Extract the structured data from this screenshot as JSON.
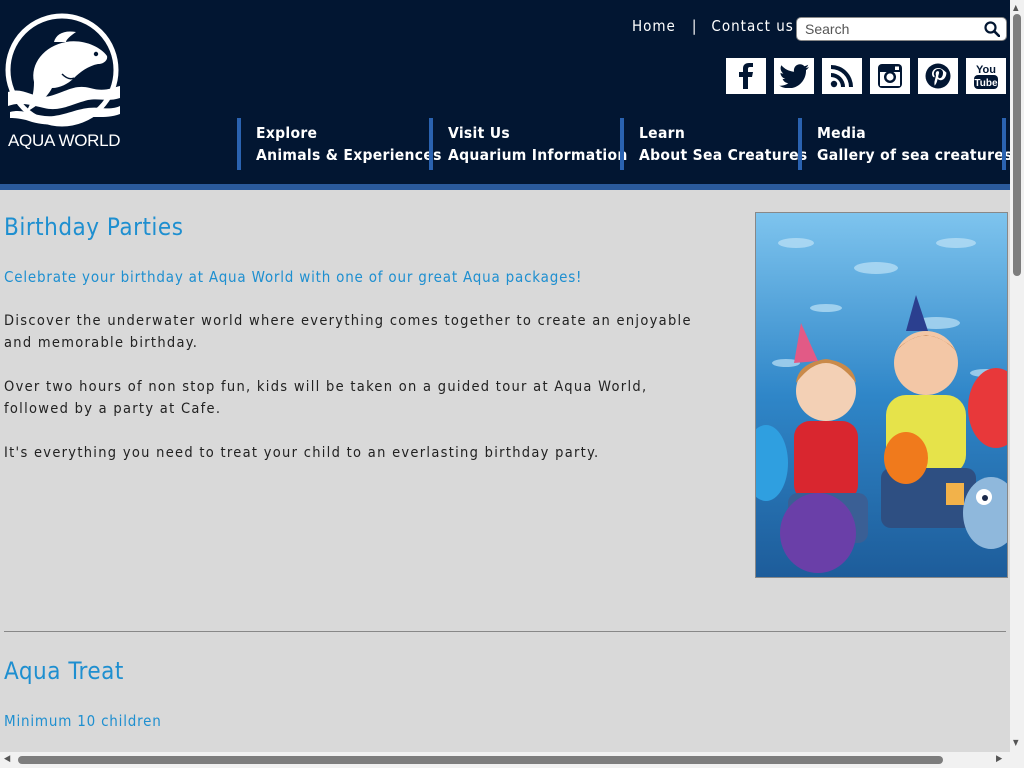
{
  "brand": {
    "name": "AQUA WORLD"
  },
  "toplinks": {
    "home": "Home",
    "separator": "|",
    "contact": "Contact us"
  },
  "search": {
    "placeholder": "Search",
    "value": ""
  },
  "social": [
    "facebook-icon",
    "twitter-icon",
    "rss-icon",
    "instagram-icon",
    "pinterest-icon",
    "youtube-icon"
  ],
  "nav": [
    {
      "line1": "Explore",
      "line2": "Animals & Experiences"
    },
    {
      "line1": "Visit Us",
      "line2": "Aquarium Information"
    },
    {
      "line1": "Learn",
      "line2": "About Sea Creatures"
    },
    {
      "line1": "Media",
      "line2": "Gallery of sea creatures"
    }
  ],
  "section1": {
    "title": "Birthday Parties",
    "subtitle": "Celebrate your birthday at Aqua World with one of our great Aqua packages!",
    "paragraphs": [
      "Discover the underwater world where everything comes together to create an enjoyable and memorable birthday.",
      "Over two hours of non stop fun, kids will be taken on a guided tour at Aqua World, followed by a party at Cafe.",
      "It's everything you need to treat your child to an everlasting birthday party."
    ]
  },
  "section2": {
    "title": "Aqua Treat",
    "subtitle": "Minimum 10 children"
  },
  "colors": {
    "header_bg": "#021632",
    "accent_blue": "#1e8fd0",
    "nav_divider": "#2a62b0",
    "page_bg": "#d9d9d9"
  }
}
